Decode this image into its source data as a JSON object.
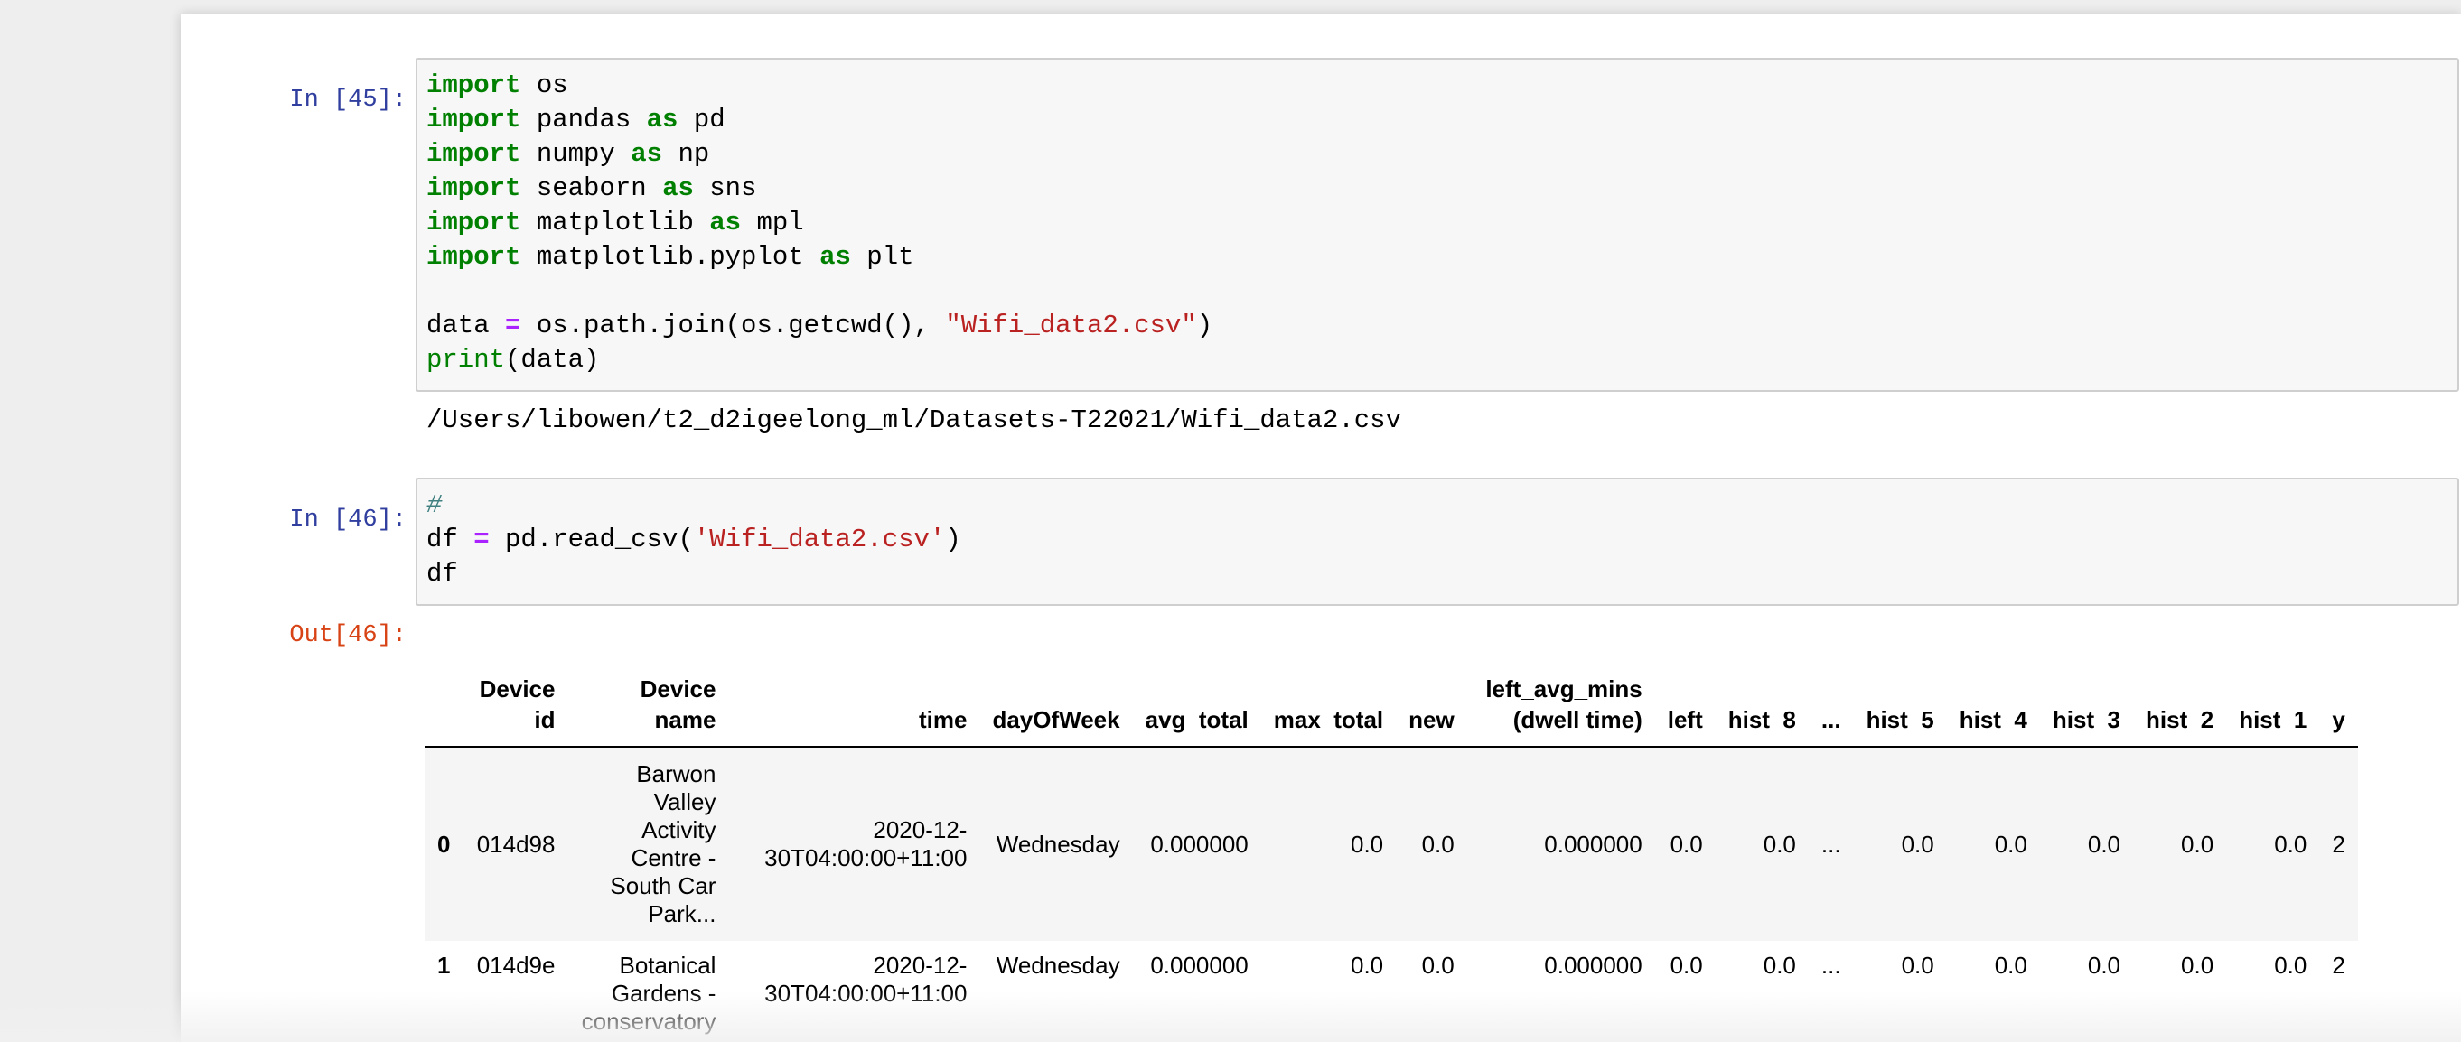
{
  "cells": [
    {
      "prompt": "In [45]:",
      "code_lines": [
        [
          {
            "t": "kw",
            "v": "import"
          },
          {
            "t": "",
            "v": " os"
          }
        ],
        [
          {
            "t": "kw",
            "v": "import"
          },
          {
            "t": "",
            "v": " pandas "
          },
          {
            "t": "kw",
            "v": "as"
          },
          {
            "t": "",
            "v": " pd"
          }
        ],
        [
          {
            "t": "kw",
            "v": "import"
          },
          {
            "t": "",
            "v": " numpy "
          },
          {
            "t": "kw",
            "v": "as"
          },
          {
            "t": "",
            "v": " np"
          }
        ],
        [
          {
            "t": "kw",
            "v": "import"
          },
          {
            "t": "",
            "v": " seaborn "
          },
          {
            "t": "kw",
            "v": "as"
          },
          {
            "t": "",
            "v": " sns"
          }
        ],
        [
          {
            "t": "kw",
            "v": "import"
          },
          {
            "t": "",
            "v": " matplotlib "
          },
          {
            "t": "kw",
            "v": "as"
          },
          {
            "t": "",
            "v": " mpl"
          }
        ],
        [
          {
            "t": "kw",
            "v": "import"
          },
          {
            "t": "",
            "v": " matplotlib.pyplot "
          },
          {
            "t": "kw",
            "v": "as"
          },
          {
            "t": "",
            "v": " plt"
          }
        ],
        [],
        [
          {
            "t": "",
            "v": "data "
          },
          {
            "t": "op",
            "v": "="
          },
          {
            "t": "",
            "v": " os.path.join(os.getcwd(), "
          },
          {
            "t": "str",
            "v": "\"Wifi_data2.csv\""
          },
          {
            "t": "",
            "v": ")"
          }
        ],
        [
          {
            "t": "bi",
            "v": "print"
          },
          {
            "t": "",
            "v": "(data)"
          }
        ]
      ],
      "stdout": "/Users/libowen/t2_d2igeelong_ml/Datasets-T22021/Wifi_data2.csv"
    },
    {
      "prompt": "In [46]:",
      "code_lines": [
        [
          {
            "t": "cm",
            "v": "#"
          }
        ],
        [
          {
            "t": "",
            "v": "df "
          },
          {
            "t": "op",
            "v": "="
          },
          {
            "t": "",
            "v": " pd.read_csv("
          },
          {
            "t": "str",
            "v": "'Wifi_data2.csv'"
          },
          {
            "t": "",
            "v": ")"
          }
        ],
        [
          {
            "t": "",
            "v": "df"
          }
        ]
      ],
      "out_prompt": "Out[46]:"
    }
  ],
  "dataframe": {
    "columns": [
      "",
      "Device id",
      "Device name",
      "time",
      "dayOfWeek",
      "avg_total",
      "max_total",
      "new",
      "left_avg_mins (dwell time)",
      "left",
      "hist_8",
      "...",
      "hist_5",
      "hist_4",
      "hist_3",
      "hist_2",
      "hist_1",
      "y"
    ],
    "rows": [
      [
        "0",
        "014d98",
        "Barwon Valley Activity Centre - South Car Park...",
        "2020-12-30T04:00:00+11:00",
        "Wednesday",
        "0.000000",
        "0.0",
        "0.0",
        "0.000000",
        "0.0",
        "0.0",
        "...",
        "0.0",
        "0.0",
        "0.0",
        "0.0",
        "0.0",
        "2"
      ],
      [
        "1",
        "014d9e",
        "Botanical Gardens - conservatory entrance",
        "2020-12-30T04:00:00+11:00",
        "Wednesday",
        "0.000000",
        "0.0",
        "0.0",
        "0.000000",
        "0.0",
        "0.0",
        "...",
        "0.0",
        "0.0",
        "0.0",
        "0.0",
        "0.0",
        "2"
      ]
    ]
  },
  "colors": {
    "keyword": "#008000",
    "string": "#ba2121",
    "operator": "#aa22ff",
    "in_prompt": "#303f9f",
    "out_prompt": "#d84315",
    "input_bg": "#f7f7f7"
  }
}
